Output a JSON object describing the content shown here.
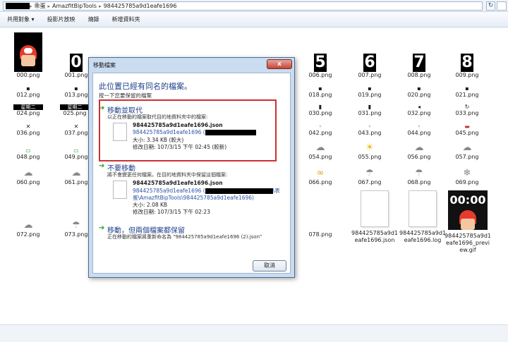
{
  "address_bar": {
    "crumbs": [
      "乖蛋",
      "AmazfitBipTools",
      "984425785a9d1eafe1696"
    ]
  },
  "toolbar": {
    "items": [
      "共用對象 ▾",
      "投影片放映",
      "燒錄",
      "新增資料夾"
    ]
  },
  "grid": {
    "row0": [
      "000.png",
      "001.png",
      "",
      "",
      "",
      "006.png",
      "007.png",
      "008.png",
      "009.png"
    ],
    "row0_digits": [
      "",
      "0",
      "",
      "",
      "",
      "5",
      "6",
      "7",
      "8"
    ],
    "row1": [
      "012.png",
      "013.png",
      "018.png",
      "019.png",
      "020.png",
      "021.png"
    ],
    "row2": [
      "024.png",
      "025.png",
      "030.png",
      "031.png",
      "032.png",
      "033.png"
    ],
    "row2_bar_text": [
      "星期二",
      "星期二"
    ],
    "row3": [
      "036.png",
      "037.png",
      "042.png",
      "043.png",
      "044.png",
      "045.png"
    ],
    "row4": [
      "048.png",
      "049.png",
      "054.png",
      "055.png",
      "056.png",
      "057.png"
    ],
    "row5": [
      "060.png",
      "061.png",
      "066.png",
      "067.png",
      "068.png",
      "069.png"
    ],
    "row6": [
      "072.png",
      "073.png",
      "078.png"
    ],
    "files": [
      {
        "name": "984425785a9d1eafe1696.json"
      },
      {
        "name": "984425785a9d1eafe1696.log"
      },
      {
        "name": "984425785a9d1eafe1696_preview.gif",
        "preview_time": "00:00"
      }
    ]
  },
  "dialog": {
    "title": "移動檔案",
    "close": "x",
    "heading": "此位置已經有同名的檔案。",
    "subheading": "按一下您要保留的檔案",
    "option1": {
      "title": "移動並取代",
      "desc": "以正在移動的檔案取代目的地資料夾中的檔案:",
      "name": "984425785a9d1eafe1696.json",
      "path": "984425785a9d1eafe1696 (",
      "size": "大小: 3.34 KB (較大)",
      "date": "修改日期: 107/3/15 下午 02:45 (較新)"
    },
    "option2": {
      "title": "不要移動",
      "desc": "將不會變更任何檔案。在目的地資料夾中保留這個檔案:",
      "name": "984425785a9d1eafe1696.json",
      "path": "984425785a9d1eafe1696 (",
      "path_suffix": "\\表",
      "path2": "蛋\\AmazfitBipTools\\984425785a9d1eafe1696)",
      "size": "大小: 2.08 KB",
      "date": "修改日期: 107/3/15 下午 02:23"
    },
    "option3": {
      "title": "移動，但兩個檔案都保留",
      "desc": "正在移動的檔案將重新命名為 \"984425785a9d1eafe1696 (2).json\""
    },
    "cancel": "取消"
  },
  "colors": {
    "highlight": "#d03030",
    "link_blue": "#1f3f8a",
    "arrow_green": "#2aa02a"
  }
}
